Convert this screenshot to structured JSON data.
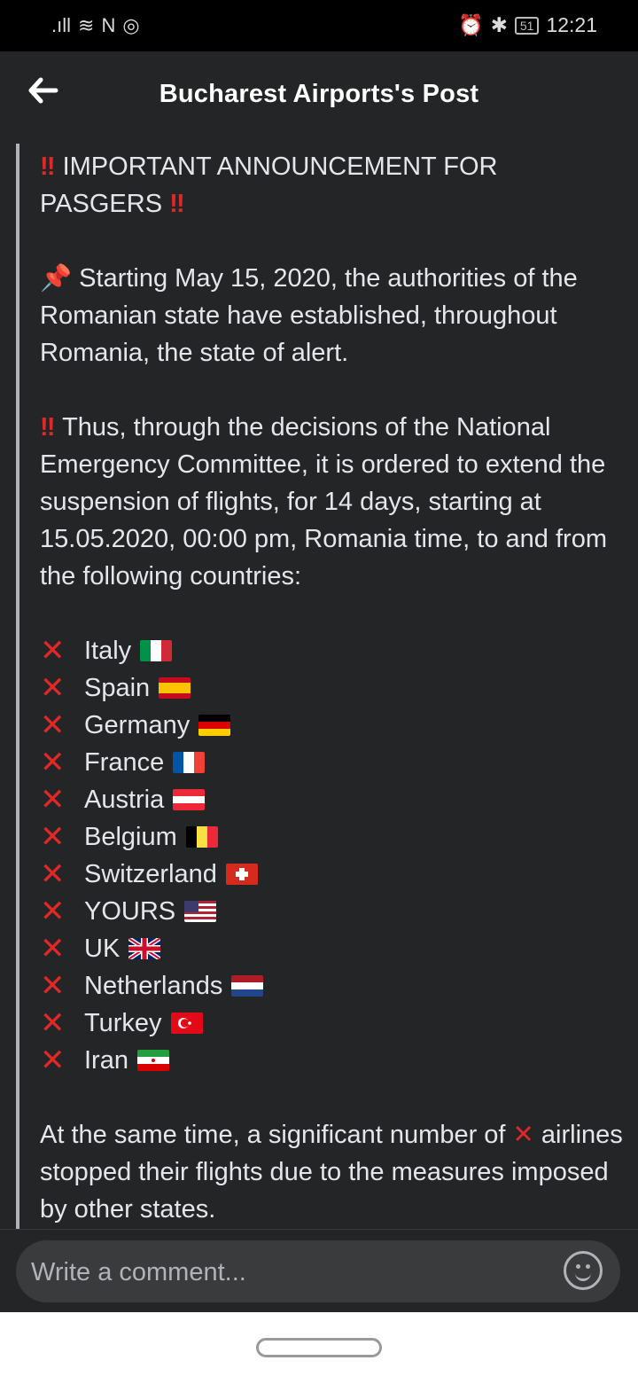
{
  "status_bar": {
    "signal": ".ıll",
    "wifi": "≋",
    "nfc": "N",
    "alarm": "⏰",
    "bluetooth": "✱",
    "battery": "51",
    "time": "12:21"
  },
  "header": {
    "title": "Bucharest Airports's Post"
  },
  "post": {
    "headline_icon": "‼",
    "headline": "IMPORTANT ANNOUNCEMENT FOR PASGERS",
    "para1_icon": "📌",
    "para1": "Starting May 15, 2020, the authorities of the Romanian state have established, throughout Romania, the state of alert.",
    "para2_icon": "‼",
    "para2": "Thus, through the decisions of the National Emergency Committee, it is ordered to extend the suspension of flights, for 14 days, starting at 15.05.2020, 00:00 pm, Romania time, to and from the following countries:",
    "countries": [
      {
        "name": "Italy",
        "flag": "flag-italy"
      },
      {
        "name": "Spain",
        "flag": "flag-spain"
      },
      {
        "name": "Germany",
        "flag": "flag-germany"
      },
      {
        "name": "France",
        "flag": "flag-france"
      },
      {
        "name": "Austria",
        "flag": "flag-austria"
      },
      {
        "name": "Belgium",
        "flag": "flag-belgium"
      },
      {
        "name": "Switzerland",
        "flag": "flag-switzerland"
      },
      {
        "name": "YOURS",
        "flag": "flag-usa"
      },
      {
        "name": "UK",
        "flag": "flag-uk"
      },
      {
        "name": "Netherlands",
        "flag": "flag-netherlands"
      },
      {
        "name": "Turkey",
        "flag": "flag-turkey"
      },
      {
        "name": "Iran",
        "flag": "flag-iran"
      }
    ],
    "x_mark": "✕",
    "para3_start": "At the same time, a significant number of",
    "para3_end": "airlines stopped their flights due to the measures imposed by other states."
  },
  "comment_bar": {
    "placeholder": "Write a comment..."
  },
  "colors": {
    "background": "#242526",
    "accent_red": "#e02828",
    "text": "#e4e6eb"
  }
}
